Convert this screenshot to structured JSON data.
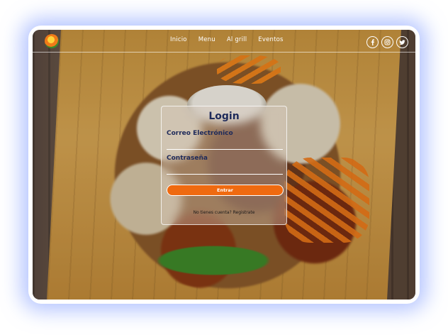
{
  "nav": {
    "links": [
      "Inicio",
      "Menu",
      "Al grill",
      "Eventos"
    ],
    "socials": [
      "facebook-icon",
      "instagram-icon",
      "twitter-icon"
    ]
  },
  "login": {
    "title": "Login",
    "email_label": "Correo Electrónico",
    "password_label": "Contraseña",
    "submit_label": "Entrar",
    "register_prompt": "No tienes cuenta?",
    "register_link": "Registrate"
  },
  "colors": {
    "accent": "#ef6a10",
    "title": "#1e2a5a",
    "glow": "#7896ff"
  }
}
